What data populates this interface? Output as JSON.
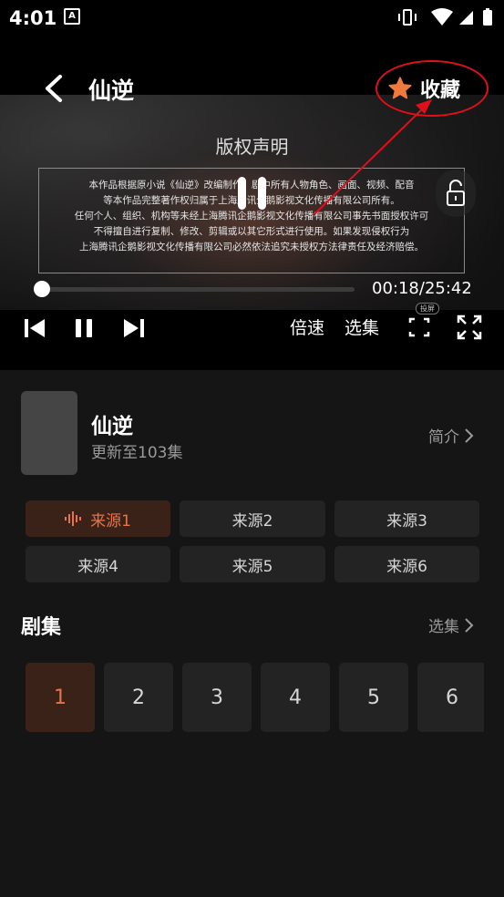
{
  "status_bar": {
    "time": "4:01",
    "notification_icon": "A"
  },
  "header": {
    "title": "仙逆",
    "favorite_label": "收藏"
  },
  "video": {
    "notice_title": "版权声明",
    "notice_lines": [
      "本作品根据原小说《仙逆》改编制作，剧中所有人物角色、画面、视频、配音",
      "等本作品完整著作权归属于上海腾讯企鹅影视文化传播有限公司所有。",
      "任何个人、组织、机构等未经上海腾讯企鹅影视文化传播有限公司事先书面授权许可",
      "不得擅自进行复制、修改、剪辑或以其它形式进行使用。如果发现侵权行为",
      "上海腾讯企鹅影视文化传播有限公司必然依法追究未授权方法律责任及经济赔偿。"
    ],
    "progress_time": "00:18/25:42",
    "progress_fraction": 0.012,
    "speed_label": "倍速",
    "episodes_label": "选集",
    "cast_tag": "投屏"
  },
  "info": {
    "name": "仙逆",
    "update": "更新至103集",
    "intro_label": "简介"
  },
  "sources": [
    {
      "label": "来源1",
      "active": true
    },
    {
      "label": "来源2",
      "active": false
    },
    {
      "label": "来源3",
      "active": false
    },
    {
      "label": "来源4",
      "active": false
    },
    {
      "label": "来源5",
      "active": false
    },
    {
      "label": "来源6",
      "active": false
    }
  ],
  "episode_section": {
    "title": "剧集",
    "select_label": "选集"
  },
  "episodes": [
    "1",
    "2",
    "3",
    "4",
    "5",
    "6"
  ],
  "colors": {
    "accent": "#e8724a",
    "annotation": "#e0101a",
    "background": "#151515"
  }
}
